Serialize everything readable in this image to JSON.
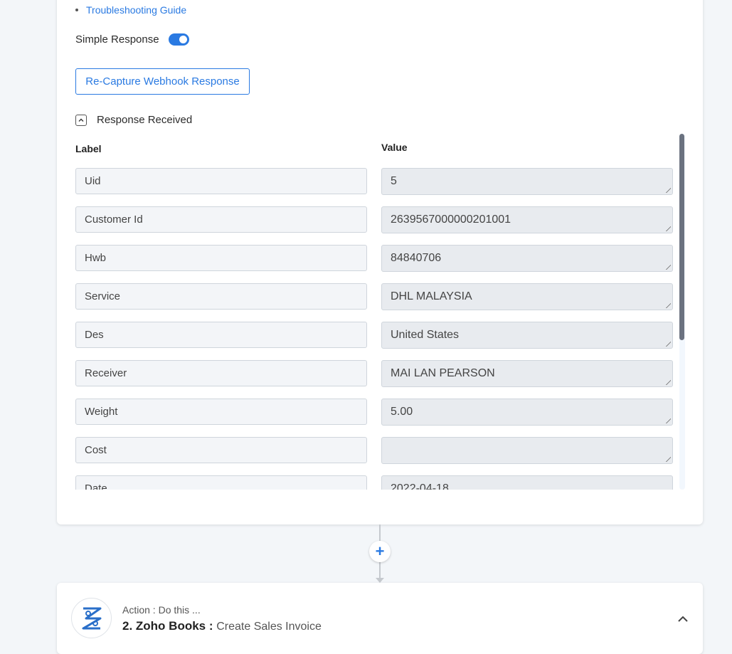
{
  "guide": {
    "link_label": "Troubleshooting Guide"
  },
  "simple_response": {
    "label": "Simple Response",
    "enabled": true
  },
  "recapture_button": {
    "label": "Re-Capture Webhook Response"
  },
  "response_section": {
    "title": "Response Received",
    "expanded": true
  },
  "table": {
    "label_header": "Label",
    "value_header": "Value",
    "rows": [
      {
        "label": "Uid",
        "value": "5"
      },
      {
        "label": "Customer Id",
        "value": "2639567000000201001"
      },
      {
        "label": "Hwb",
        "value": "84840706"
      },
      {
        "label": "Service",
        "value": "DHL MALAYSIA"
      },
      {
        "label": "Des",
        "value": "United States"
      },
      {
        "label": "Receiver",
        "value": "MAI LAN PEARSON"
      },
      {
        "label": "Weight",
        "value": "5.00"
      },
      {
        "label": "Cost",
        "value": ""
      },
      {
        "label": "Date",
        "value": "2022-04-18"
      }
    ]
  },
  "connector": {
    "add_icon": "plus-icon"
  },
  "action_step": {
    "subtitle": "Action : Do this ...",
    "app_name": "2. Zoho Books :",
    "event_name": "Create Sales Invoice",
    "logo_icon": "zoho-books-logo",
    "collapse_icon": "chevron-up-icon"
  },
  "colors": {
    "accent": "#2a7ae2",
    "background": "#f3f6f9"
  }
}
